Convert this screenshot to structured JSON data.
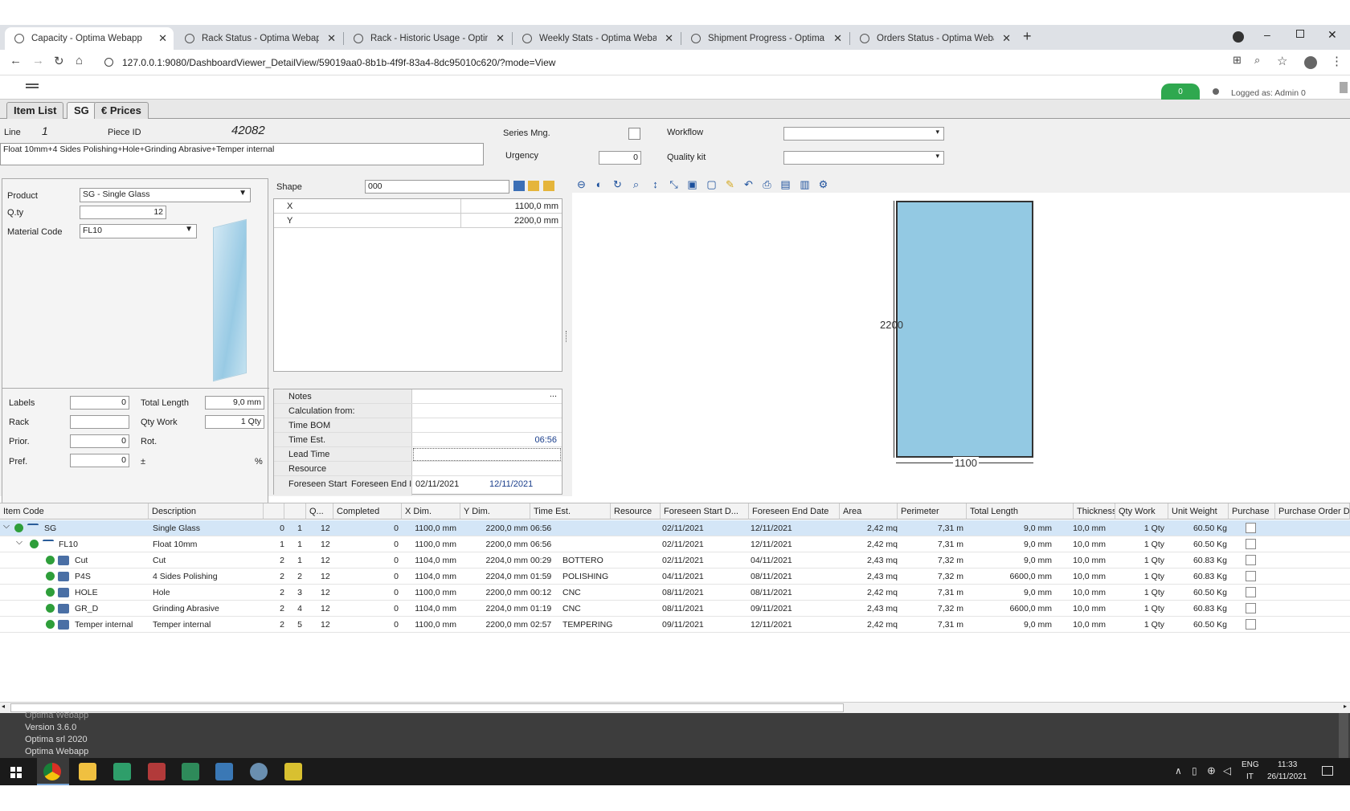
{
  "browser": {
    "tabs": [
      {
        "title": "Capacity - Optima Webapp",
        "active": true
      },
      {
        "title": "Rack Status - Optima Webapp"
      },
      {
        "title": "Rack - Historic Usage - Optima W"
      },
      {
        "title": "Weekly Stats - Optima Webapp"
      },
      {
        "title": "Shipment Progress - Optima We"
      },
      {
        "title": "Orders Status - Optima Webapp"
      }
    ],
    "new_tab": "+",
    "url": "127.0.0.1:9080/DashboardViewer_DetailView/59019aa0-8b1b-4f9f-83a4-8dc95010c620/?mode=View"
  },
  "app_header": {
    "badge": "0",
    "logged_as": "Logged as: Admin 0"
  },
  "main_tabs": [
    "Item List",
    "SG",
    "€ Prices"
  ],
  "form": {
    "line_label": "Line",
    "line_value": "1",
    "piece_id_label": "Piece ID",
    "piece_id_value": "42082",
    "description": "Float 10mm+4 Sides Polishing+Hole+Grinding Abrasive+Temper internal",
    "series_label": "Series Mng.",
    "urgency_label": "Urgency",
    "urgency_value": "0",
    "workflow_label": "Workflow",
    "quality_label": "Quality kit",
    "product_label": "Product",
    "product_value": "SG - Single Glass",
    "qty_label": "Q.ty",
    "qty_value": "12",
    "material_label": "Material Code",
    "material_value": "FL10",
    "labels_label": "Labels",
    "labels_value": "0",
    "rack_label": "Rack",
    "rack_value": "",
    "prior_label": "Prior.",
    "prior_value": "0",
    "pref_label": "Pref.",
    "pref_value": "0",
    "total_length_label": "Total Length",
    "total_length_value": "9,0 mm",
    "qty_work_label": "Qty Work",
    "qty_work_value": "1 Qty",
    "rot_label": "Rot.",
    "pm_label": "±",
    "percent_label": "%",
    "shape_label": "Shape",
    "shape_value": "000",
    "dims": [
      {
        "name": "X",
        "value": "1100,0 mm"
      },
      {
        "name": "Y",
        "value": "2200,0 mm"
      }
    ],
    "notes": [
      {
        "name": "Notes",
        "value": "..."
      },
      {
        "name": "Calculation from:",
        "value": ""
      },
      {
        "name": "Time BOM",
        "value": ""
      },
      {
        "name": "Time Est.",
        "value": "06:56"
      },
      {
        "name": "Lead Time",
        "value": ""
      },
      {
        "name": "Resource",
        "value": ""
      }
    ],
    "foreseen_start_label": "Foreseen Start",
    "foreseen_end_label": "Foreseen End I",
    "foreseen_start_value": "02/11/2021",
    "foreseen_end_value": "12/11/2021"
  },
  "drawing": {
    "height_label": "2200",
    "width_label": "1100",
    "fill": "#93c9e3"
  },
  "grid": {
    "columns": [
      "Item Code",
      "Description",
      "",
      "",
      "Q...",
      "Completed",
      "X Dim.",
      "Y Dim.",
      "Time Est.",
      "Resource",
      "Foreseen Start D...",
      "Foreseen End Date",
      "Area",
      "Perimeter",
      "Total Length",
      "Thickness",
      "Qty Work",
      "Unit Weight",
      "Purchase",
      "Purchase Order D"
    ],
    "rows": [
      {
        "code": "SG",
        "desc": "Single Glass",
        "a": "0",
        "b": "1",
        "q": "12",
        "comp": "0",
        "x": "1100,0 mm",
        "y": "2200,0 mm",
        "time": "06:56",
        "res": "",
        "start": "02/11/2021",
        "end": "12/11/2021",
        "area": "2,42 mq",
        "per": "7,31 m",
        "tl": "9,0 mm",
        "th": "10,0 mm",
        "qw": "1 Qty",
        "uw": "60.50 Kg"
      },
      {
        "code": "FL10",
        "desc": "Float 10mm",
        "a": "1",
        "b": "1",
        "q": "12",
        "comp": "0",
        "x": "1100,0 mm",
        "y": "2200,0 mm",
        "time": "06:56",
        "res": "",
        "start": "02/11/2021",
        "end": "12/11/2021",
        "area": "2,42 mq",
        "per": "7,31 m",
        "tl": "9,0 mm",
        "th": "10,0 mm",
        "qw": "1 Qty",
        "uw": "60.50 Kg"
      },
      {
        "code": "Cut",
        "desc": "Cut",
        "a": "2",
        "b": "1",
        "q": "12",
        "comp": "0",
        "x": "1104,0 mm",
        "y": "2204,0 mm",
        "time": "00:29",
        "res": "BOTTERO",
        "start": "02/11/2021",
        "end": "04/11/2021",
        "area": "2,43 mq",
        "per": "7,32 m",
        "tl": "9,0 mm",
        "th": "10,0 mm",
        "qw": "1 Qty",
        "uw": "60.83 Kg"
      },
      {
        "code": "P4S",
        "desc": "4 Sides Polishing",
        "a": "2",
        "b": "2",
        "q": "12",
        "comp": "0",
        "x": "1104,0 mm",
        "y": "2204,0 mm",
        "time": "01:59",
        "res": "POLISHING",
        "start": "04/11/2021",
        "end": "08/11/2021",
        "area": "2,43 mq",
        "per": "7,32 m",
        "tl": "6600,0 mm",
        "th": "10,0 mm",
        "qw": "1 Qty",
        "uw": "60.83 Kg"
      },
      {
        "code": "HOLE",
        "desc": "Hole",
        "a": "2",
        "b": "3",
        "q": "12",
        "comp": "0",
        "x": "1100,0 mm",
        "y": "2200,0 mm",
        "time": "00:12",
        "res": "CNC",
        "start": "08/11/2021",
        "end": "08/11/2021",
        "area": "2,42 mq",
        "per": "7,31 m",
        "tl": "9,0 mm",
        "th": "10,0 mm",
        "qw": "1 Qty",
        "uw": "60.50 Kg"
      },
      {
        "code": "GR_D",
        "desc": "Grinding Abrasive",
        "a": "2",
        "b": "4",
        "q": "12",
        "comp": "0",
        "x": "1104,0 mm",
        "y": "2204,0 mm",
        "time": "01:19",
        "res": "CNC",
        "start": "08/11/2021",
        "end": "09/11/2021",
        "area": "2,43 mq",
        "per": "7,32 m",
        "tl": "6600,0 mm",
        "th": "10,0 mm",
        "qw": "1 Qty",
        "uw": "60.83 Kg"
      },
      {
        "code": "Temper internal",
        "desc": "Temper internal",
        "a": "2",
        "b": "5",
        "q": "12",
        "comp": "0",
        "x": "1100,0 mm",
        "y": "2200,0 mm",
        "time": "02:57",
        "res": "TEMPERING",
        "start": "09/11/2021",
        "end": "12/11/2021",
        "area": "2,42 mq",
        "per": "7,31 m",
        "tl": "9,0 mm",
        "th": "10,0 mm",
        "qw": "1 Qty",
        "uw": "60.50 Kg"
      }
    ]
  },
  "footer": [
    "Optima Webapp",
    "Version 3.6.0",
    "Optima srl 2020",
    "Optima Webapp"
  ],
  "taskbar": {
    "lang": "ENG",
    "region": "IT",
    "time": "11:33",
    "date": "26/11/2021"
  }
}
